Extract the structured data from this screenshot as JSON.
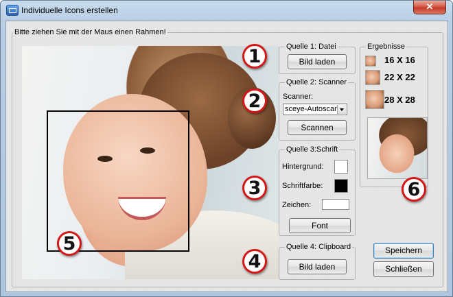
{
  "window": {
    "title": "Individuelle Icons erstellen",
    "close_glyph": "✕"
  },
  "main_group": {
    "label": "Bitte ziehen Sie mit der Maus einen Rahmen!"
  },
  "source1": {
    "label": "Quelle 1: Datei",
    "button": "Bild laden"
  },
  "source2": {
    "label": "Quelle 2: Scanner",
    "scanner_label": "Scanner:",
    "scanner_value": "sceye-Autoscan",
    "button": "Scannen"
  },
  "source3": {
    "label": "Quelle 3:Schrift",
    "background_label": "Hintergrund:",
    "background_color": "#ffffff",
    "font_color_label": "Schriftfarbe:",
    "font_color": "#000000",
    "chars_label": "Zeichen:",
    "chars_value": "",
    "button": "Font"
  },
  "source4": {
    "label": "Quelle 4: Clipboard",
    "button": "Bild laden"
  },
  "results": {
    "label": "Ergebnisse",
    "sizes": [
      "16 X 16",
      "22 X 22",
      "28 X 28"
    ]
  },
  "actions": {
    "save": "Speichern",
    "close": "Schließen"
  },
  "badges": [
    "1",
    "2",
    "3",
    "4",
    "5",
    "6"
  ]
}
